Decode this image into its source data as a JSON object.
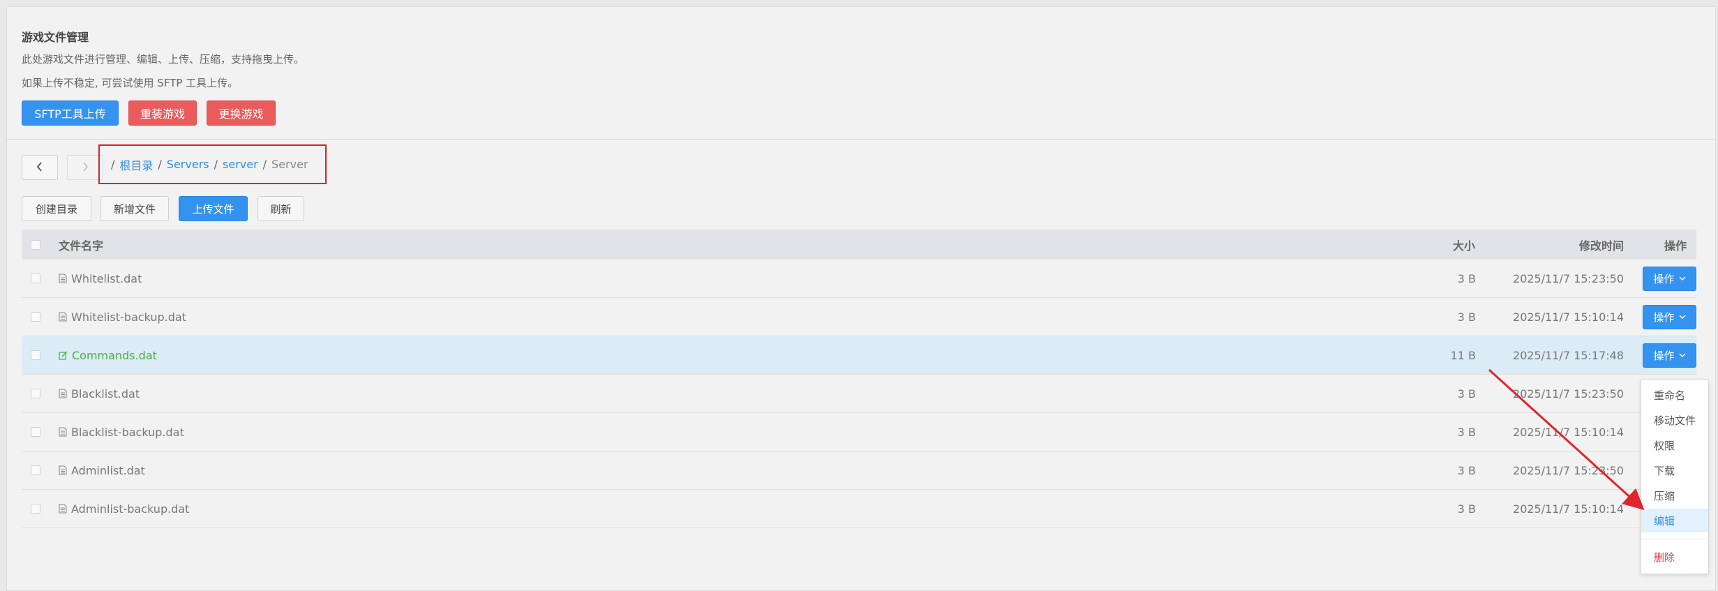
{
  "header": {
    "title": "游戏文件管理",
    "description1": "此处游戏文件进行管理、编辑、上传、压缩，支持拖曳上传。",
    "description2": "如果上传不稳定, 可尝试使用 SFTP 工具上传。",
    "buttons": {
      "sftp": "SFTP工具上传",
      "reinstall": "重装游戏",
      "change": "更换游戏"
    }
  },
  "nav": {
    "back_icon": "chevron-left-icon",
    "forward_icon": "chevron-right-icon",
    "breadcrumb": [
      "根目录",
      "Servers",
      "server",
      "Server"
    ]
  },
  "toolbar": {
    "create_dir": "创建目录",
    "new_file": "新增文件",
    "upload": "上传文件",
    "refresh": "刷新"
  },
  "table": {
    "headers": {
      "name": "文件名字",
      "size": "大小",
      "mtime": "修改时间",
      "ops": "操作"
    },
    "op_label": "操作",
    "rows": [
      {
        "name": "Whitelist.dat",
        "size": "3 B",
        "mtime": "2025/11/7 15:23:50",
        "selected": false
      },
      {
        "name": "Whitelist-backup.dat",
        "size": "3 B",
        "mtime": "2025/11/7 15:10:14",
        "selected": false
      },
      {
        "name": "Commands.dat",
        "size": "11 B",
        "mtime": "2025/11/7 15:17:48",
        "selected": true
      },
      {
        "name": "Blacklist.dat",
        "size": "3 B",
        "mtime": "2025/11/7 15:23:50",
        "selected": false
      },
      {
        "name": "Blacklist-backup.dat",
        "size": "3 B",
        "mtime": "2025/11/7 15:10:14",
        "selected": false
      },
      {
        "name": "Adminlist.dat",
        "size": "3 B",
        "mtime": "2025/11/7 15:23:50",
        "selected": false
      },
      {
        "name": "Adminlist-backup.dat",
        "size": "3 B",
        "mtime": "2025/11/7 15:10:14",
        "selected": false
      }
    ]
  },
  "dropdown": {
    "items": [
      "重命名",
      "移动文件",
      "权限",
      "下载",
      "压缩",
      "编辑"
    ],
    "delete": "删除",
    "active": "编辑"
  },
  "colors": {
    "primary": "#3593f0",
    "danger": "#ea5b5b",
    "highlight_box": "#d8232a",
    "selected_row": "#dbecf7",
    "file_edited": "#4cae3d"
  }
}
